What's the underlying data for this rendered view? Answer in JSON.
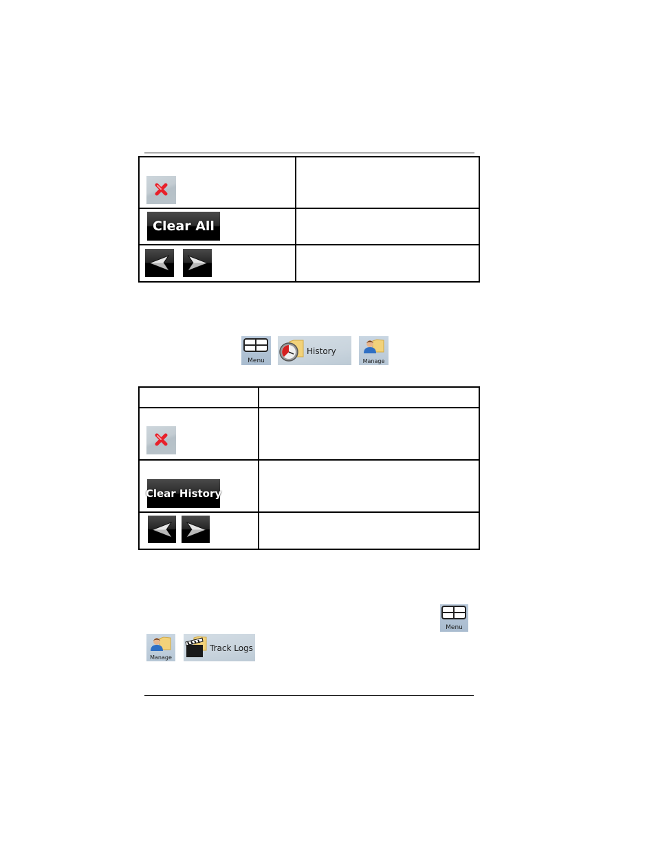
{
  "page": {
    "top_rule": true,
    "bottom_rule": true
  },
  "table1": {
    "rows": [
      {
        "control": "delete-icon-button",
        "description": ""
      },
      {
        "control": "clear-all-button",
        "label": "Clear All",
        "description": ""
      },
      {
        "control": "arrow-buttons",
        "description": ""
      }
    ]
  },
  "nav_path_history": {
    "buttons": [
      {
        "icon": "menu-grid-icon",
        "label": "Menu"
      },
      {
        "icon": "clock-folder-icon",
        "label": "History"
      },
      {
        "icon": "user-folder-icon",
        "label": "Manage"
      }
    ]
  },
  "table2": {
    "header": [
      "",
      ""
    ],
    "rows": [
      {
        "control": "delete-icon-button",
        "description": ""
      },
      {
        "control": "clear-history-button",
        "label": "Clear History",
        "description": ""
      },
      {
        "control": "arrow-buttons",
        "description": ""
      }
    ]
  },
  "nav_path_tracklogs": {
    "buttons": [
      {
        "icon": "menu-grid-icon",
        "label": "Menu"
      },
      {
        "icon": "user-folder-icon",
        "label": "Manage"
      },
      {
        "icon": "clapperboard-folder-icon",
        "label": "Track Logs"
      }
    ]
  },
  "colors": {
    "tile_blue": "#b0c2d4",
    "delete_red": "#e8202a",
    "button_black": "#000000"
  }
}
